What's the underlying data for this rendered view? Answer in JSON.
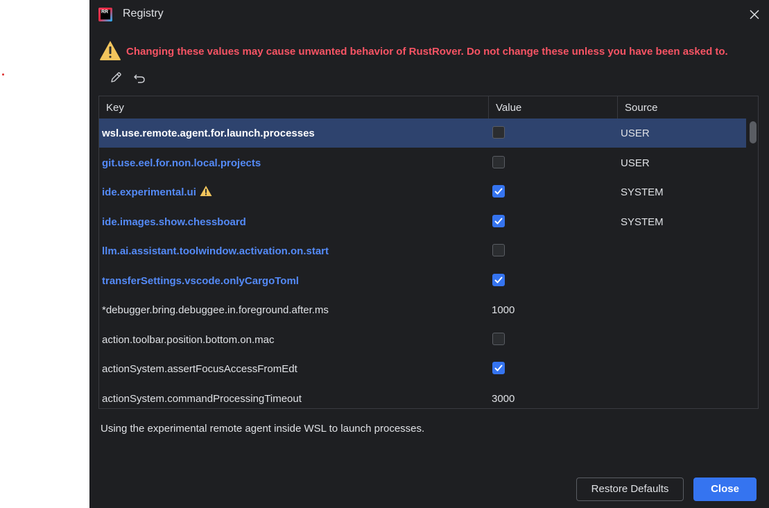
{
  "window": {
    "title": "Registry"
  },
  "warning": {
    "text": "Changing these values may cause unwanted behavior of RustRover. Do not change these unless you have been asked to."
  },
  "table": {
    "headers": {
      "key": "Key",
      "value": "Value",
      "source": "Source"
    },
    "rows": [
      {
        "key": "wsl.use.remote.agent.for.launch.processes",
        "type": "checkbox",
        "checked": false,
        "value": "",
        "source": "USER",
        "changed": true,
        "selected": true,
        "warning": false
      },
      {
        "key": "git.use.eel.for.non.local.projects",
        "type": "checkbox",
        "checked": false,
        "value": "",
        "source": "USER",
        "changed": true,
        "selected": false,
        "warning": false
      },
      {
        "key": "ide.experimental.ui",
        "type": "checkbox",
        "checked": true,
        "value": "",
        "source": "SYSTEM",
        "changed": true,
        "selected": false,
        "warning": true
      },
      {
        "key": "ide.images.show.chessboard",
        "type": "checkbox",
        "checked": true,
        "value": "",
        "source": "SYSTEM",
        "changed": true,
        "selected": false,
        "warning": false
      },
      {
        "key": "llm.ai.assistant.toolwindow.activation.on.start",
        "type": "checkbox",
        "checked": false,
        "value": "",
        "source": "",
        "changed": true,
        "selected": false,
        "warning": false
      },
      {
        "key": "transferSettings.vscode.onlyCargoToml",
        "type": "checkbox",
        "checked": true,
        "value": "",
        "source": "",
        "changed": true,
        "selected": false,
        "warning": false
      },
      {
        "key": "*debugger.bring.debuggee.in.foreground.after.ms",
        "type": "text",
        "checked": false,
        "value": "1000",
        "source": "",
        "changed": false,
        "selected": false,
        "warning": false
      },
      {
        "key": "action.toolbar.position.bottom.on.mac",
        "type": "checkbox",
        "checked": false,
        "value": "",
        "source": "",
        "changed": false,
        "selected": false,
        "warning": false
      },
      {
        "key": "actionSystem.assertFocusAccessFromEdt",
        "type": "checkbox",
        "checked": true,
        "value": "",
        "source": "",
        "changed": false,
        "selected": false,
        "warning": false
      },
      {
        "key": "actionSystem.commandProcessingTimeout",
        "type": "text",
        "checked": false,
        "value": "3000",
        "source": "",
        "changed": false,
        "selected": false,
        "warning": false
      }
    ]
  },
  "description": "Using the experimental remote agent inside WSL to launch processes.",
  "buttons": {
    "restore": "Restore Defaults",
    "close": "Close"
  },
  "icons": {
    "app": "rustrover-logo-icon",
    "close": "close-icon",
    "warning": "warning-icon",
    "edit": "pencil-icon",
    "revert": "undo-icon"
  },
  "colors": {
    "background": "#1e1f22",
    "warning_text": "#f75464",
    "changed_key": "#548af7",
    "selection": "#2e436e",
    "accent": "#3574f0",
    "warning_icon": "#f2c55c"
  }
}
